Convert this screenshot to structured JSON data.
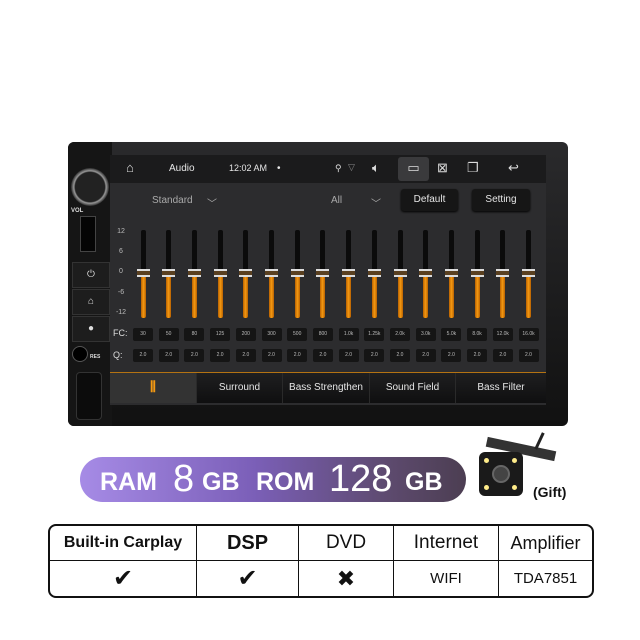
{
  "device": {
    "side_labels": {
      "vol": "VOL",
      "res": "RES"
    }
  },
  "statusbar": {
    "title": "Audio",
    "time": "12:02 AM",
    "dot": "•",
    "icons": [
      "home-icon",
      "location-icon",
      "wifi-icon",
      "volume-icon",
      "screenshot-icon",
      "close-app-icon",
      "recent-apps-icon",
      "back-icon"
    ]
  },
  "controls": {
    "preset": "Standard",
    "channel": "All",
    "default_label": "Default",
    "setting_label": "Setting"
  },
  "eq": {
    "y_ticks": [
      "12",
      "6",
      "0",
      "-6",
      "-12"
    ],
    "gain_range": [
      -12,
      12
    ],
    "fc_label": "FC:",
    "q_label": "Q:",
    "bands": [
      {
        "fc": "30",
        "q": "2.0",
        "gain": 0
      },
      {
        "fc": "50",
        "q": "2.0",
        "gain": 0
      },
      {
        "fc": "80",
        "q": "2.0",
        "gain": 0
      },
      {
        "fc": "125",
        "q": "2.0",
        "gain": 0
      },
      {
        "fc": "200",
        "q": "2.0",
        "gain": 0
      },
      {
        "fc": "300",
        "q": "2.0",
        "gain": 0
      },
      {
        "fc": "500",
        "q": "2.0",
        "gain": 0
      },
      {
        "fc": "800",
        "q": "2.0",
        "gain": 0
      },
      {
        "fc": "1.0k",
        "q": "2.0",
        "gain": 0
      },
      {
        "fc": "1.25k",
        "q": "2.0",
        "gain": 0
      },
      {
        "fc": "2.0k",
        "q": "2.0",
        "gain": 0
      },
      {
        "fc": "3.0k",
        "q": "2.0",
        "gain": 0
      },
      {
        "fc": "5.0k",
        "q": "2.0",
        "gain": 0
      },
      {
        "fc": "8.0k",
        "q": "2.0",
        "gain": 0
      },
      {
        "fc": "12.0k",
        "q": "2.0",
        "gain": 0
      },
      {
        "fc": "16.0k",
        "q": "2.0",
        "gain": 0
      }
    ],
    "accent": "#f59a12"
  },
  "tabs": [
    {
      "label": ""
    },
    {
      "label": "Surround"
    },
    {
      "label": "Bass Strengthen"
    },
    {
      "label": "Sound Field"
    },
    {
      "label": "Bass Filter"
    }
  ],
  "promo": {
    "ram_label": "RAM",
    "ram_value": "8",
    "ram_unit": "GB",
    "rom_label": "ROM",
    "rom_value": "128",
    "rom_unit": "GB",
    "gift": "(Gift)"
  },
  "spec_table": {
    "headers": [
      "Built-in Carplay",
      "DSP",
      "DVD",
      "Internet",
      "Amplifier"
    ],
    "values": [
      "✔",
      "✔",
      "✖",
      "WIFI",
      "TDA7851"
    ]
  }
}
